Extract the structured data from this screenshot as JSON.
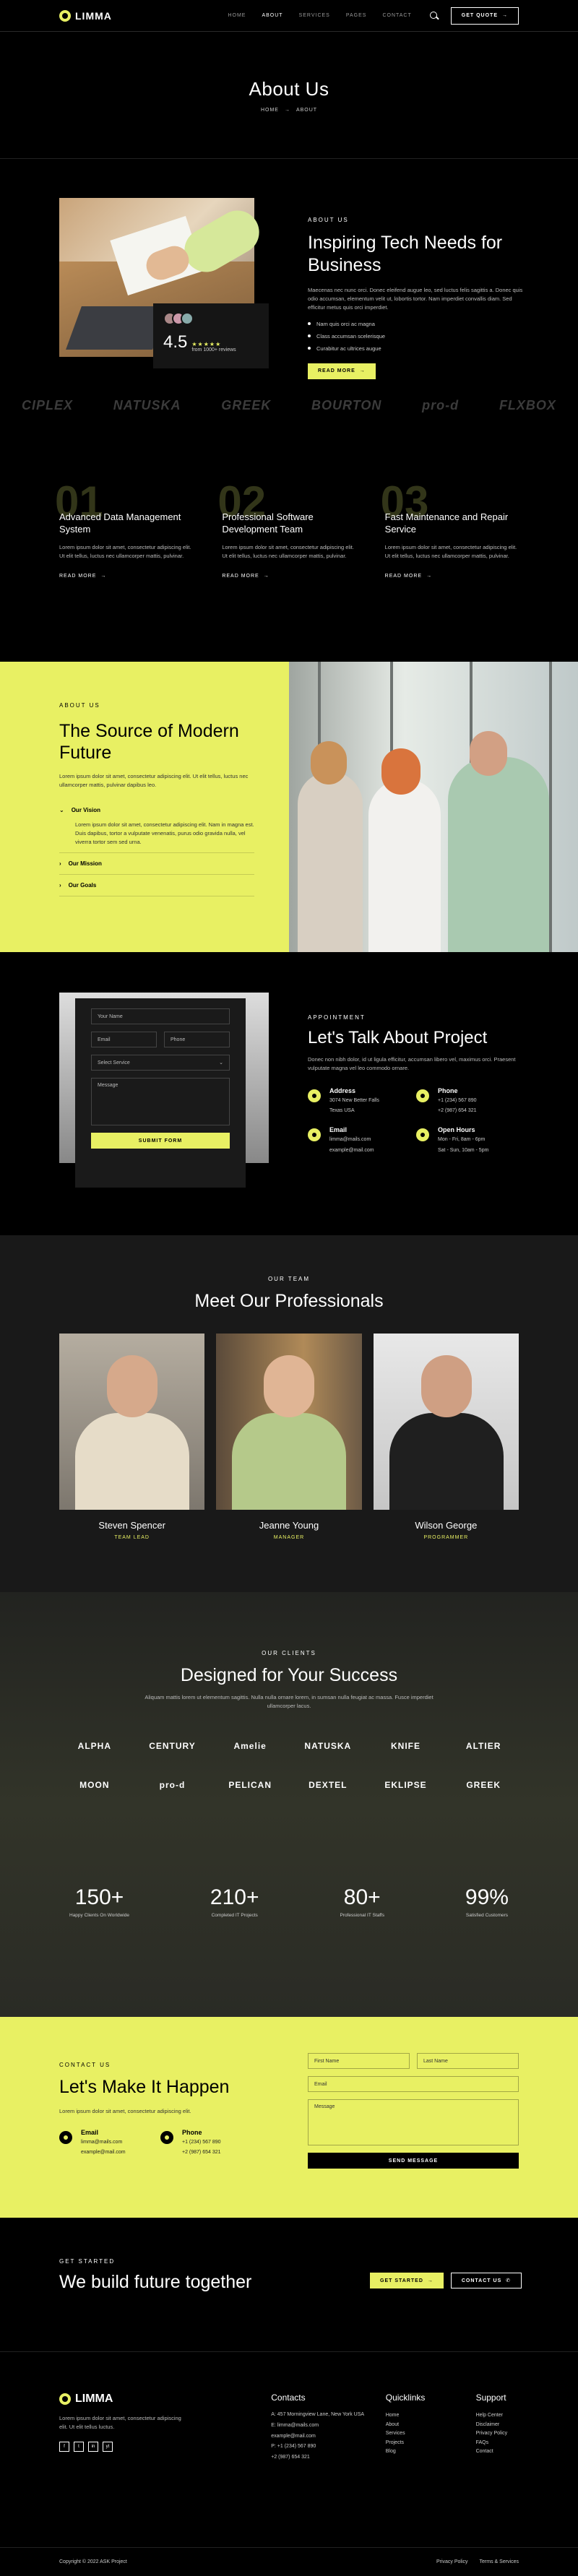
{
  "header": {
    "brand": "LIMMA",
    "nav": [
      "HOME",
      "ABOUT",
      "SERVICES",
      "PAGES",
      "CONTACT"
    ],
    "active_nav": "ABOUT",
    "cta": "GET QUOTE"
  },
  "hero": {
    "title": "About Us",
    "crumb_home": "HOME",
    "crumb_current": "ABOUT"
  },
  "about": {
    "eyebrow": "ABOUT US",
    "title": "Inspiring Tech Needs for Business",
    "text": "Maecenas nec nunc orci. Donec eleifend augue leo, sed luctus felis sagittis a. Donec quis odio accumsan, elementum velit ut, lobortis tortor. Nam imperdiet convallis diam. Sed efficitur metus quis orci imperdiet.",
    "bullets": [
      "Nam quis orci ac magna",
      "Class accumsan scelerisque",
      "Curabitur ac ultrices augue"
    ],
    "button": "READ MORE",
    "rating": "4.5",
    "stars": "★★★★★",
    "reviews": "from 1000+ reviews"
  },
  "brands": [
    "CIPLEX",
    "NATUSKA",
    "GREEK",
    "BOURTON",
    "pro-d",
    "FLXBOX"
  ],
  "services": [
    {
      "num": "01",
      "title": "Advanced Data Management System",
      "text": "Lorem ipsum dolor sit amet, consectetur adipiscing elit. Ut elit tellus, luctus nec ullamcorper mattis, pulvinar.",
      "more": "READ MORE"
    },
    {
      "num": "02",
      "title": "Professional Software Development Team",
      "text": "Lorem ipsum dolor sit amet, consectetur adipiscing elit. Ut elit tellus, luctus nec ullamcorper mattis, pulvinar.",
      "more": "READ MORE"
    },
    {
      "num": "03",
      "title": "Fast Maintenance and Repair Service",
      "text": "Lorem ipsum dolor sit amet, consectetur adipiscing elit. Ut elit tellus, luctus nec ullamcorper mattis, pulvinar.",
      "more": "READ MORE"
    }
  ],
  "source": {
    "eyebrow": "ABOUT US",
    "title": "The Source of Modern Future",
    "text": "Lorem ipsum dolor sit amet, consectetur adipiscing elit. Ut elit tellus, luctus nec ullamcorper mattis, pulvinar dapibus leo.",
    "accordion": [
      {
        "label": "Our Vision",
        "body": "Lorem ipsum dolor sit amet, consectetur adipiscing elit. Nam in magna est. Duis dapibus, tortor a vulputate venenatis, purus odio gravida nulla, vel viverra tortor sem sed urna."
      },
      {
        "label": "Our Mission"
      },
      {
        "label": "Our Goals"
      }
    ]
  },
  "appointment": {
    "form": {
      "name": "Your Name",
      "email": "Email",
      "phone": "Phone",
      "service": "Select Service",
      "message": "Message",
      "submit": "SUBMIT FORM"
    },
    "eyebrow": "APPOINTMENT",
    "title": "Let's Talk About Project",
    "text": "Donec non nibh dolor, id ut ligula efficitur, accumsan libero vel, maximus orci. Praesent vulputate magna vel leo commodo ornare.",
    "contacts": [
      {
        "label": "Address",
        "lines": [
          "3074 New Better Falls",
          "Texas USA"
        ]
      },
      {
        "label": "Phone",
        "lines": [
          "+1 (234) 567 890",
          "+2 (987) 654 321"
        ]
      },
      {
        "label": "Email",
        "lines": [
          "limma@mails.com",
          "example@mail.com"
        ]
      },
      {
        "label": "Open Hours",
        "lines": [
          "Mon - Fri, 8am - 6pm",
          "Sat - Sun, 10am - 5pm"
        ]
      }
    ]
  },
  "team": {
    "eyebrow": "OUR TEAM",
    "title": "Meet Our Professionals",
    "members": [
      {
        "name": "Steven Spencer",
        "role": "TEAM LEAD"
      },
      {
        "name": "Jeanne Young",
        "role": "MANAGER"
      },
      {
        "name": "Wilson George",
        "role": "PROGRAMMER"
      }
    ]
  },
  "clients": {
    "eyebrow": "OUR CLIENTS",
    "title": "Designed for Your Success",
    "text": "Aliquam mattis lorem ut elementum sagittis. Nulla nulla ornare lorem, in sumsan nulla feugiat ac massa. Fusce imperdiet ullamcorper lacus.",
    "logos": [
      "ALPHA",
      "CENTURY",
      "Amelie",
      "NATUSKA",
      "KNIFE",
      "ALTIER",
      "MOON",
      "pro-d",
      "PELICAN",
      "DEXTEL",
      "EKLIPSE",
      "GREEK"
    ],
    "stats": [
      {
        "value": "150+",
        "label": "Happy Clients On Worldwide"
      },
      {
        "value": "210+",
        "label": "Completed IT Projects"
      },
      {
        "value": "80+",
        "label": "Professional IT Staffs"
      },
      {
        "value": "99%",
        "label": "Satisfied Customers"
      }
    ]
  },
  "contact": {
    "eyebrow": "CONTACT US",
    "title": "Let's Make It Happen",
    "text": "Lorem ipsum dolor sit amet, consectetur adipiscing elit.",
    "email_label": "Email",
    "email_lines": [
      "limma@mails.com",
      "example@mail.com"
    ],
    "phone_label": "Phone",
    "phone_lines": [
      "+1 (234) 567 890",
      "+2 (987) 654 321"
    ],
    "form": {
      "first": "First Name",
      "last": "Last Name",
      "email": "Email",
      "message": "Message",
      "submit": "SEND MESSAGE"
    }
  },
  "started": {
    "eyebrow": "GET STARTED",
    "title": "We build future together",
    "btn1": "GET STARTED",
    "btn2": "CONTACT US"
  },
  "footer": {
    "brand": "LIMMA",
    "text": "Lorem ipsum dolor sit amet, consectetur adipiscing elit. Ut elit tellus luctus.",
    "social": [
      "f",
      "t",
      "in",
      "yt"
    ],
    "contacts_title": "Contacts",
    "contacts": [
      "A: 457 Morningview Lane, New York USA",
      "E: limma@mails.com",
      "example@mail.com",
      "P: +1 (234) 567 890",
      "+2 (987) 654 321"
    ],
    "quick_title": "Quicklinks",
    "quick": [
      "Home",
      "About",
      "Services",
      "Projects",
      "Blog"
    ],
    "support_title": "Support",
    "support": [
      "Help Center",
      "Disclaimer",
      "Privacy Policy",
      "FAQs",
      "Contact"
    ]
  },
  "copyright": {
    "text": "Copyright © 2022 ASK Project",
    "links": [
      "Privacy Policy",
      "Terms & Services"
    ]
  }
}
